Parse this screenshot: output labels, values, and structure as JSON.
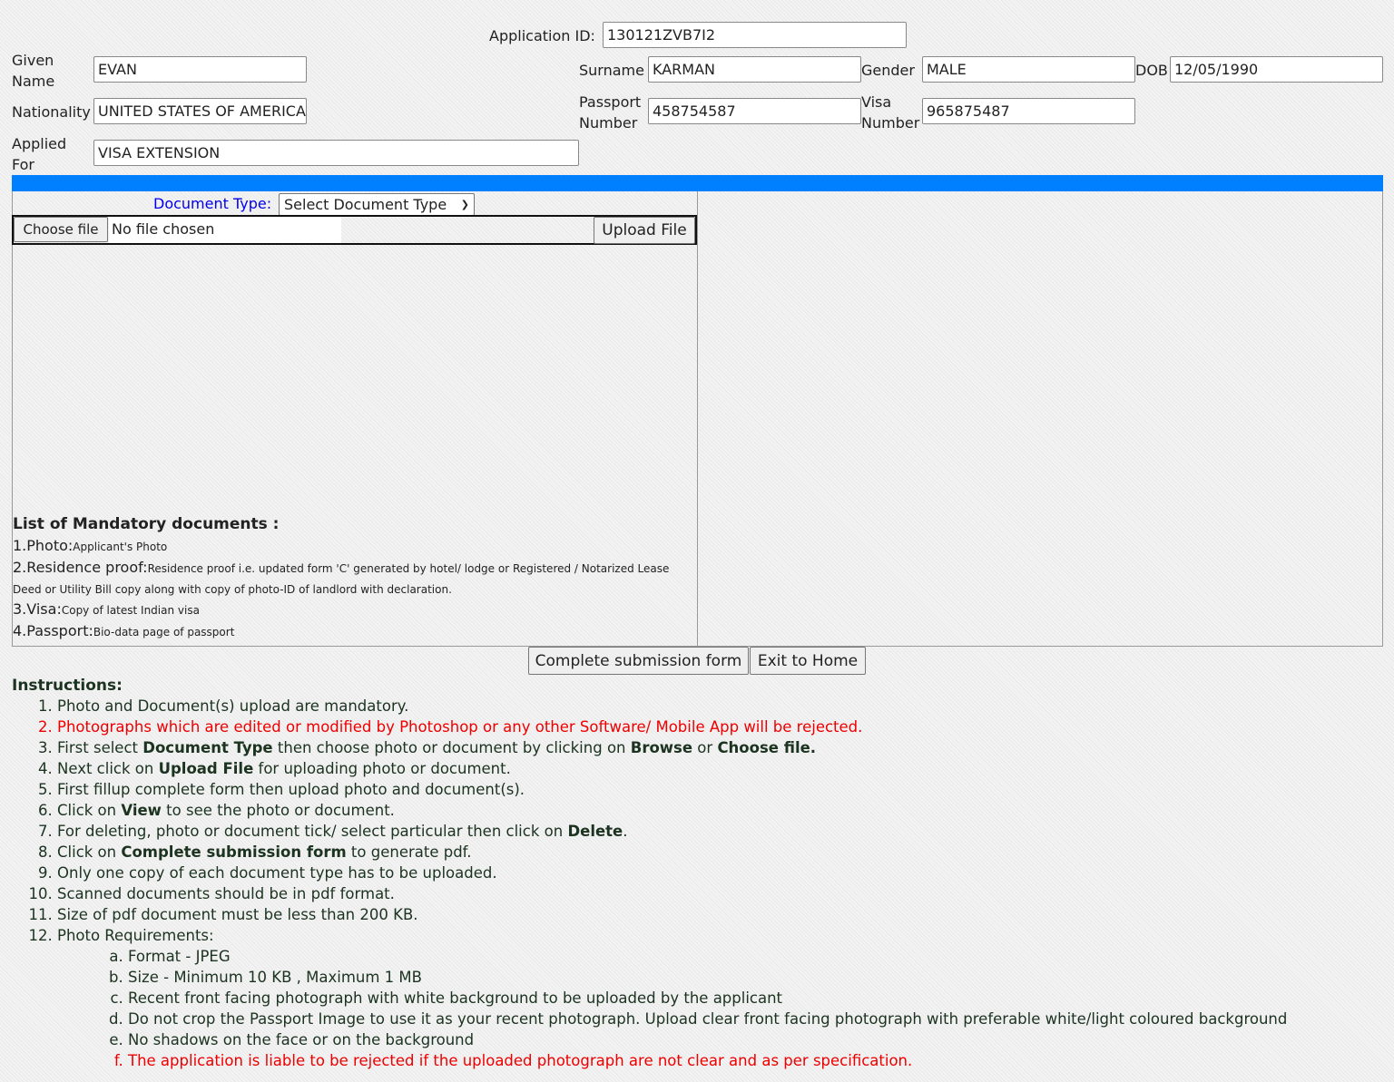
{
  "form": {
    "application_id_label": "Application ID:",
    "application_id": "130121ZVB7I2",
    "given_name_label": "Given Name",
    "given_name": "EVAN",
    "surname_label": "Surname",
    "surname": "KARMAN",
    "gender_label": "Gender",
    "gender": "MALE",
    "dob_label": "DOB",
    "dob": "12/05/1990",
    "nationality_label": "Nationality",
    "nationality": "UNITED STATES OF AMERICA",
    "passport_label": "Passport Number",
    "passport": "458754587",
    "visa_label": "Visa Number",
    "visa": "965875487",
    "applied_for_label": "Applied For",
    "applied_for": "VISA EXTENSION"
  },
  "upload": {
    "doc_type_label": "Document Type:",
    "doc_type_selected": "Select Document Type",
    "choose_file": "Choose file",
    "no_file": "No file chosen",
    "upload_button": "Upload File"
  },
  "mandatory": {
    "title": "List of Mandatory documents :",
    "items": [
      {
        "label": "1.Photo:",
        "desc": "Applicant's Photo"
      },
      {
        "label": "2.Residence proof:",
        "desc": "Residence proof i.e. updated form 'C' generated by hotel/ lodge or Registered / Notarized Lease Deed or Utility Bill copy along with copy of photo-ID of landlord with declaration."
      },
      {
        "label": "3.Visa:",
        "desc": "Copy of latest Indian visa"
      },
      {
        "label": "4.Passport:",
        "desc": "Bio-data page of passport"
      }
    ]
  },
  "actions": {
    "complete": "Complete submission form",
    "exit": "Exit to Home"
  },
  "colors": {
    "accent_bar": "#0080ff",
    "warning": "#e00000",
    "doc_type_label": "#0000ff"
  },
  "instructions": {
    "title": "Instructions:",
    "items": [
      {
        "red": false,
        "parts": [
          {
            "t": "Photo and Document(s) upload are mandatory."
          }
        ]
      },
      {
        "red": true,
        "parts": [
          {
            "t": "Photographs which are edited or modified by Photoshop or any other Software/ Mobile App will be rejected."
          }
        ]
      },
      {
        "red": false,
        "parts": [
          {
            "t": "First select "
          },
          {
            "t": "Document Type",
            "b": true
          },
          {
            "t": " then choose photo or document by clicking on "
          },
          {
            "t": "Browse",
            "b": true
          },
          {
            "t": " or "
          },
          {
            "t": "Choose file.",
            "b": true
          }
        ]
      },
      {
        "red": false,
        "parts": [
          {
            "t": "Next click on "
          },
          {
            "t": "Upload File",
            "b": true
          },
          {
            "t": " for uploading photo or document."
          }
        ]
      },
      {
        "red": false,
        "parts": [
          {
            "t": "First fillup complete form then upload photo and document(s)."
          }
        ]
      },
      {
        "red": false,
        "parts": [
          {
            "t": "Click on "
          },
          {
            "t": "View",
            "b": true
          },
          {
            "t": " to see the photo or document."
          }
        ]
      },
      {
        "red": false,
        "parts": [
          {
            "t": "For deleting, photo or document tick/ select particular then click on "
          },
          {
            "t": "Delete",
            "b": true
          },
          {
            "t": "."
          }
        ]
      },
      {
        "red": false,
        "parts": [
          {
            "t": "Click on "
          },
          {
            "t": "Complete submission form",
            "b": true
          },
          {
            "t": " to generate pdf."
          }
        ]
      },
      {
        "red": false,
        "parts": [
          {
            "t": "Only one copy of each document type has to be uploaded."
          }
        ]
      },
      {
        "red": false,
        "parts": [
          {
            "t": "Scanned documents should be in pdf format."
          }
        ]
      },
      {
        "red": false,
        "parts": [
          {
            "t": "Size of pdf document must be less than 200 KB."
          }
        ]
      },
      {
        "red": false,
        "parts": [
          {
            "t": "Photo Requirements:"
          }
        ]
      }
    ],
    "photo_requirements": [
      {
        "red": false,
        "t": "Format - JPEG"
      },
      {
        "red": false,
        "t": "Size - Minimum 10 KB , Maximum 1 MB"
      },
      {
        "red": false,
        "t": "Recent front facing photograph with white background to be uploaded by the applicant"
      },
      {
        "red": false,
        "t": "Do not crop the Passport Image to use it as your recent photograph. Upload clear front facing photograph with preferable white/light coloured background"
      },
      {
        "red": false,
        "t": "No shadows on the face or on the background"
      },
      {
        "red": true,
        "t": "The application is liable to be rejected if the uploaded photograph are not clear and as per specification."
      }
    ]
  }
}
